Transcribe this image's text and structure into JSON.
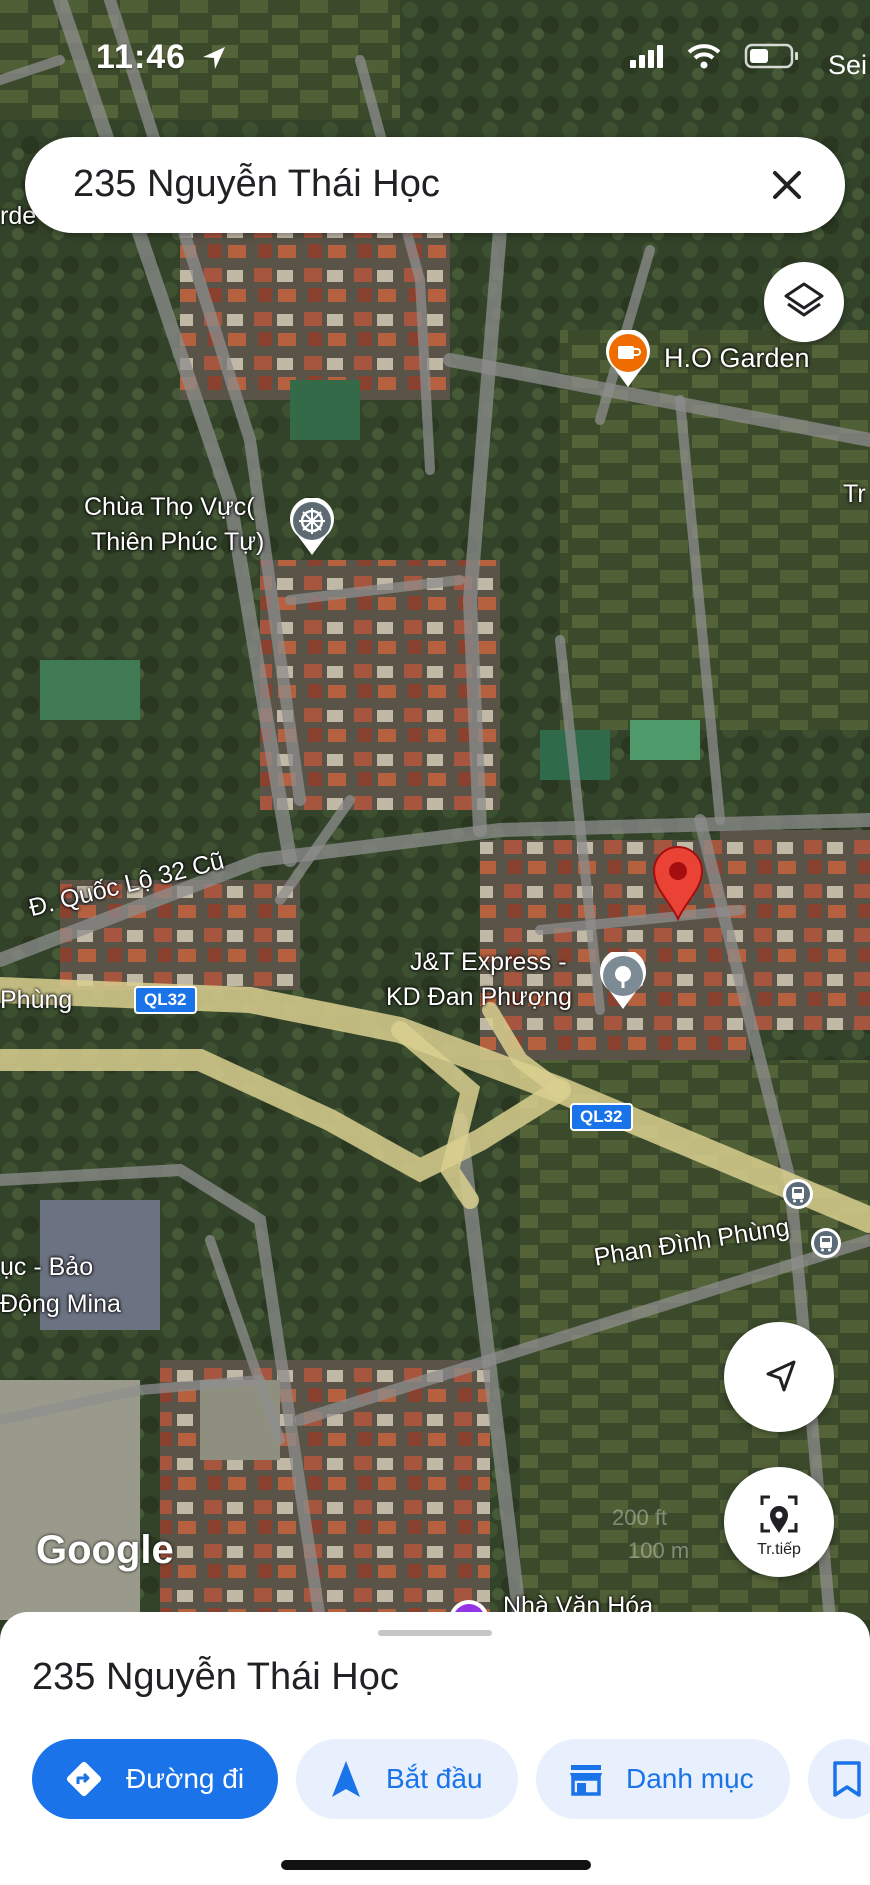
{
  "status_bar": {
    "time": "11:46",
    "corner_text": "Sei"
  },
  "search": {
    "query": "235 Nguyễn Thái Học"
  },
  "map": {
    "labels": {
      "ho_garden": "H.O Garden",
      "chua_line1": "Chùa Thọ Vực(",
      "chua_line2": "Thiên Phúc Tự)",
      "quoc_lo": "Đ. Quốc Lộ 32 Cũ",
      "jt_line1": "J&T Express -",
      "jt_line2": "KD Đan Phượng",
      "ql32_a": "QL32",
      "ql32_b": "QL32",
      "phan_dinh_phung": "Phan Đình Phùng",
      "phung_left": "Phùng",
      "bao_line1": "ục - Bảo",
      "bao_line2": "Động Mina",
      "nha_van_hoa": "Nhà Văn Hóa",
      "edge_tr": "Tr",
      "edge_rde": "rde",
      "google": "Google",
      "scale_ft": "200 ft",
      "scale_m": "100 m"
    },
    "live_view_label": "Tr.tiếp"
  },
  "sheet": {
    "title": "235 Nguyễn Thái Học",
    "chips": [
      {
        "label": "Đường đi",
        "icon": "directions-icon"
      },
      {
        "label": "Bắt đầu",
        "icon": "navigation-arrow-icon"
      },
      {
        "label": "Danh mục",
        "icon": "store-icon"
      }
    ]
  },
  "colors": {
    "accent": "#1a73e8",
    "pin": "#ea4335",
    "highway": "#d9cf8f"
  }
}
